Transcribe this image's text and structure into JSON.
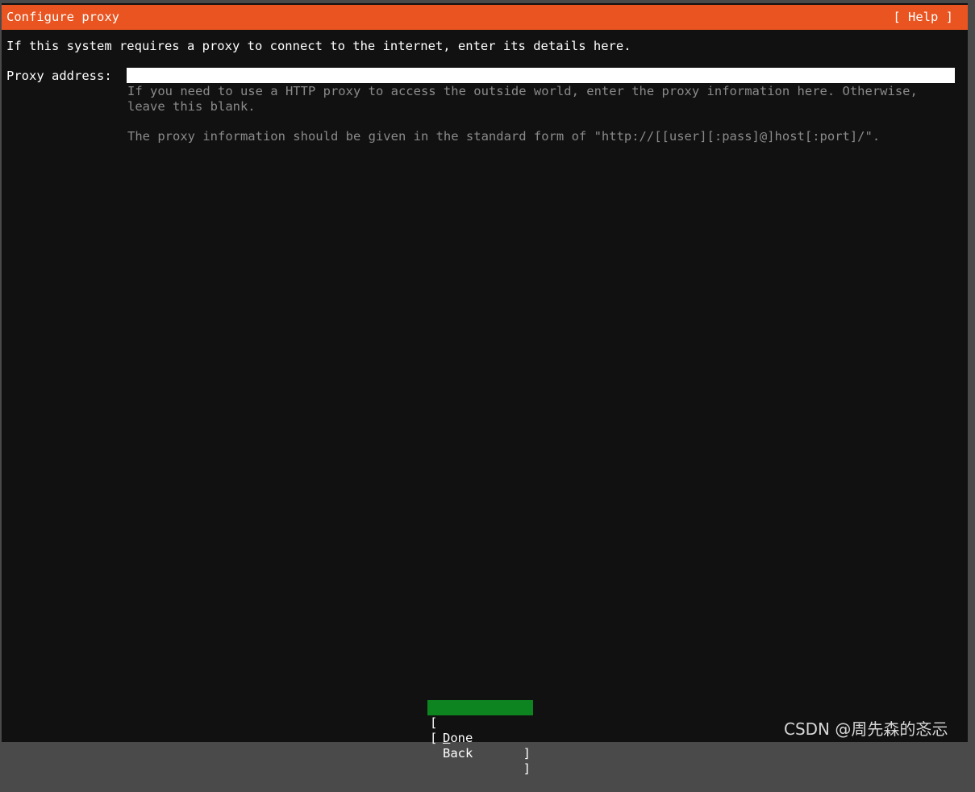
{
  "header": {
    "title": "Configure proxy",
    "help_label": "[ Help ]"
  },
  "intro_text": "If this system requires a proxy to connect to the internet, enter its details here.",
  "proxy": {
    "label": "Proxy address:",
    "value": "",
    "help_line1": "If you need to use a HTTP proxy to access the outside world, enter the proxy information here. Otherwise,",
    "help_line2": "leave this blank.",
    "help_format": "The proxy information should be given in the standard form of \"http://[[user][:pass]@]host[:port]/\"."
  },
  "buttons": {
    "done": {
      "open": "[",
      "accel": "D",
      "rest": "one",
      "close": "]"
    },
    "back": {
      "open": "[",
      "label": "Back",
      "close": "]"
    }
  },
  "watermark": "CSDN @周先森的忞忈",
  "colors": {
    "titlebar": "#e95420",
    "background": "#111111",
    "focused_button": "#0e8420",
    "help_text": "#8a8a8a"
  }
}
